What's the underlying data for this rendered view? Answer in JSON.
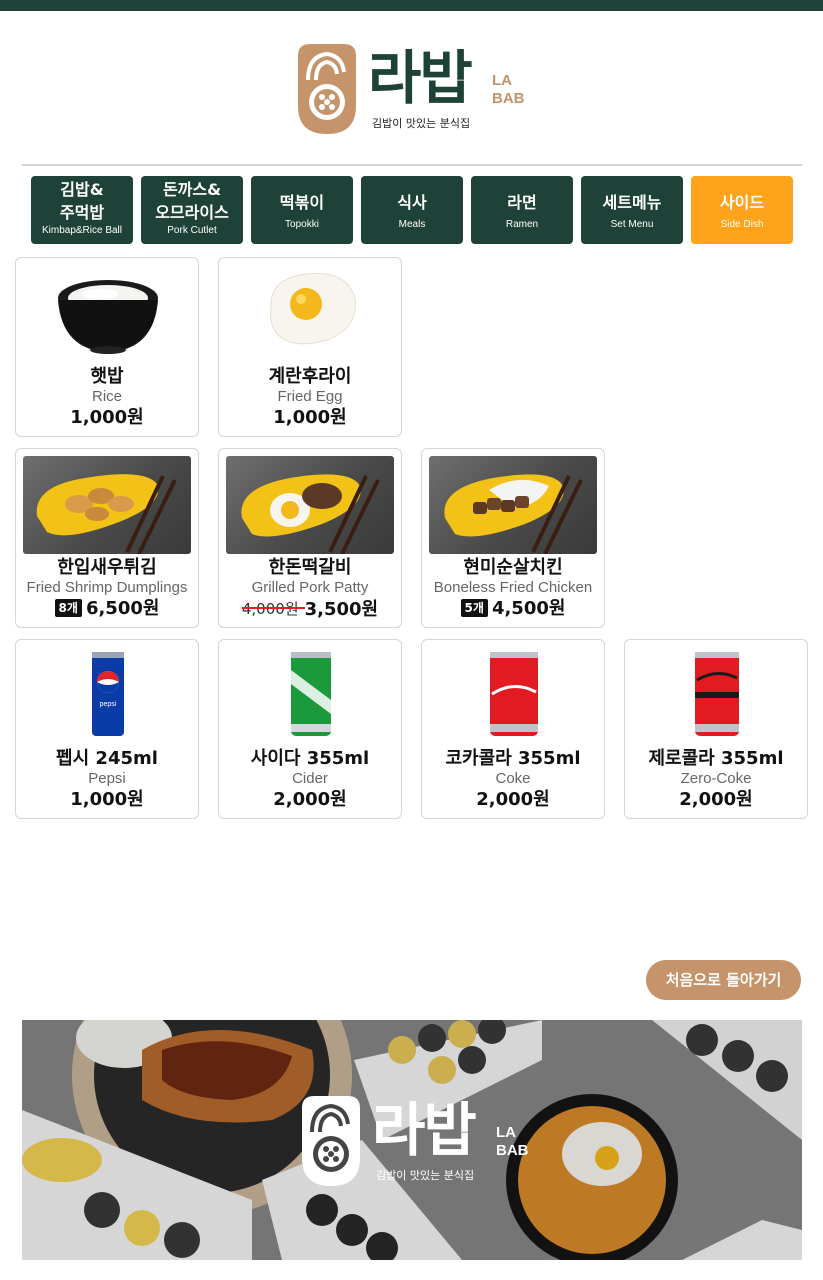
{
  "brand": {
    "name": "라밥",
    "en_line1": "LA",
    "en_line2": "BAB",
    "tagline": "김밥이 맛있는 분식집"
  },
  "colors": {
    "primary": "#1f4238",
    "accent": "#ffa31a",
    "brown": "#c5946a"
  },
  "tabs": [
    {
      "ko_line1": "김밥&",
      "ko_line2": "주먹밥",
      "en": "Kimbap&Rice Ball",
      "active": false
    },
    {
      "ko_line1": "돈까스&",
      "ko_line2": "오므라이스",
      "en": "Pork Cutlet",
      "active": false
    },
    {
      "ko": "떡볶이",
      "en": "Topokki",
      "active": false
    },
    {
      "ko": "식사",
      "en": "Meals",
      "active": false
    },
    {
      "ko": "라면",
      "en": "Ramen",
      "active": false
    },
    {
      "ko": "세트메뉴",
      "en": "Set Menu",
      "active": false
    },
    {
      "ko": "사이드",
      "en": "Side Dish",
      "active": true
    }
  ],
  "items": [
    {
      "name": "햇밥",
      "en": "Rice",
      "price": "1,000원",
      "icon": "rice-bowl-icon"
    },
    {
      "name": "계란후라이",
      "en": "Fried Egg",
      "price": "1,000원",
      "icon": "fried-egg-icon"
    },
    {
      "name": "한입새우튀김",
      "en": "Fried Shrimp Dumplings",
      "badge": "8개",
      "price": "6,500원",
      "icon": "shrimp-dumplings-photo"
    },
    {
      "name": "한돈떡갈비",
      "en": "Grilled Pork Patty",
      "old_price": "4,000원",
      "price": "3,500원",
      "icon": "pork-patty-photo"
    },
    {
      "name": "현미순살치킨",
      "en": "Boneless Fried Chicken",
      "badge": "5개",
      "price": "4,500원",
      "icon": "fried-chicken-photo"
    },
    {
      "name": "펩시 245ml",
      "en": "Pepsi",
      "price": "1,000원",
      "icon": "pepsi-can-icon"
    },
    {
      "name": "사이다 355ml",
      "en": "Cider",
      "price": "2,000원",
      "icon": "cider-can-icon"
    },
    {
      "name": "코카콜라 355ml",
      "en": "Coke",
      "price": "2,000원",
      "icon": "coke-can-icon"
    },
    {
      "name": "제로콜라 355ml",
      "en": "Zero-Coke",
      "price": "2,000원",
      "icon": "zero-coke-can-icon"
    }
  ],
  "back_button": "처음으로 돌아가기"
}
